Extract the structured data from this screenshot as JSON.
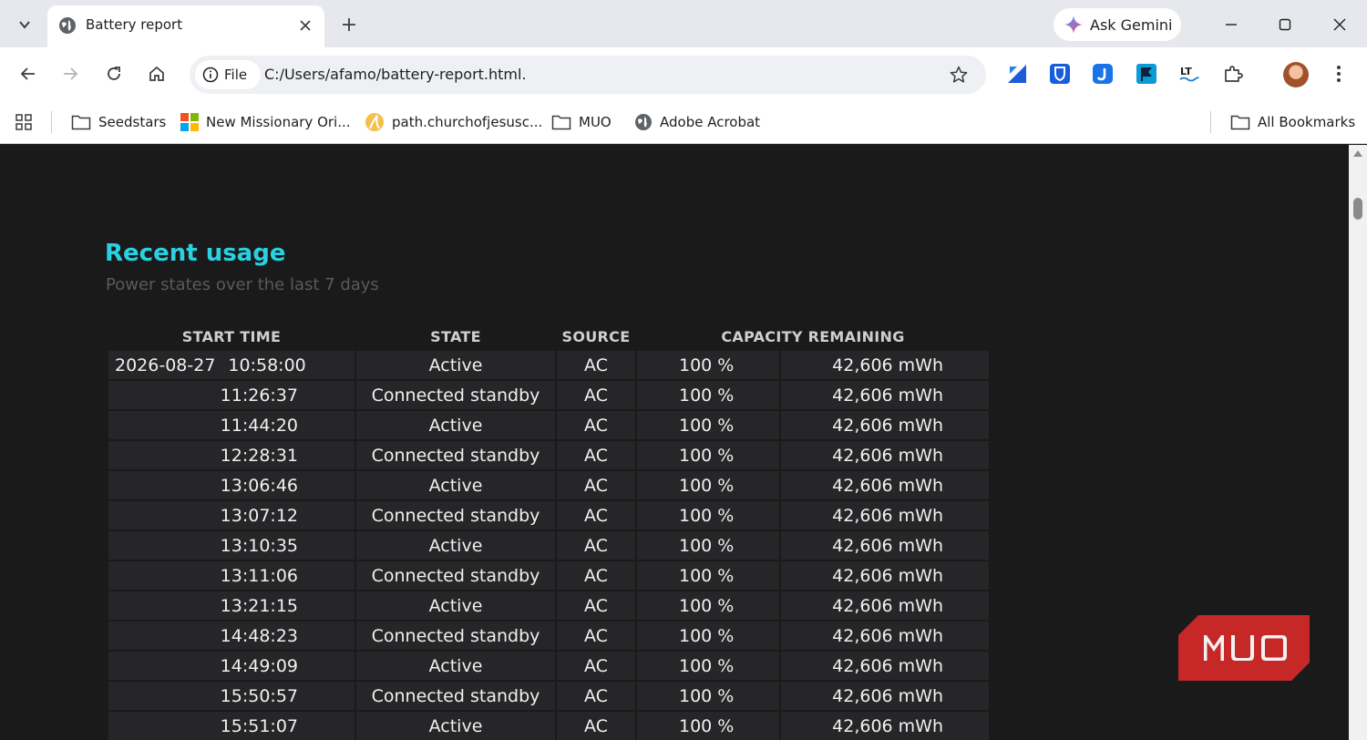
{
  "browser": {
    "tab_title": "Battery report",
    "ask_gemini_label": "Ask Gemini",
    "file_chip_label": "File",
    "url": "C:/Users/afamo/battery-report.html."
  },
  "bookmarks": {
    "items": [
      "Seedstars",
      "New Missionary Ori...",
      "path.churchofjesusc...",
      "MUO",
      "Adobe Acrobat"
    ],
    "all_bookmarks_label": "All Bookmarks"
  },
  "report": {
    "heading": "Recent usage",
    "subheading": "Power states over the last 7 days",
    "columns": [
      "START TIME",
      "STATE",
      "SOURCE",
      "CAPACITY REMAINING"
    ],
    "first_date": "2026-08-27",
    "rows": [
      {
        "time": "10:58:00",
        "state": "Active",
        "source": "AC",
        "percent": "100 %",
        "mwh": "42,606 mWh"
      },
      {
        "time": "11:26:37",
        "state": "Connected standby",
        "source": "AC",
        "percent": "100 %",
        "mwh": "42,606 mWh"
      },
      {
        "time": "11:44:20",
        "state": "Active",
        "source": "AC",
        "percent": "100 %",
        "mwh": "42,606 mWh"
      },
      {
        "time": "12:28:31",
        "state": "Connected standby",
        "source": "AC",
        "percent": "100 %",
        "mwh": "42,606 mWh"
      },
      {
        "time": "13:06:46",
        "state": "Active",
        "source": "AC",
        "percent": "100 %",
        "mwh": "42,606 mWh"
      },
      {
        "time": "13:07:12",
        "state": "Connected standby",
        "source": "AC",
        "percent": "100 %",
        "mwh": "42,606 mWh"
      },
      {
        "time": "13:10:35",
        "state": "Active",
        "source": "AC",
        "percent": "100 %",
        "mwh": "42,606 mWh"
      },
      {
        "time": "13:11:06",
        "state": "Connected standby",
        "source": "AC",
        "percent": "100 %",
        "mwh": "42,606 mWh"
      },
      {
        "time": "13:21:15",
        "state": "Active",
        "source": "AC",
        "percent": "100 %",
        "mwh": "42,606 mWh"
      },
      {
        "time": "14:48:23",
        "state": "Connected standby",
        "source": "AC",
        "percent": "100 %",
        "mwh": "42,606 mWh"
      },
      {
        "time": "14:49:09",
        "state": "Active",
        "source": "AC",
        "percent": "100 %",
        "mwh": "42,606 mWh"
      },
      {
        "time": "15:50:57",
        "state": "Connected standby",
        "source": "AC",
        "percent": "100 %",
        "mwh": "42,606 mWh"
      },
      {
        "time": "15:51:07",
        "state": "Active",
        "source": "AC",
        "percent": "100 %",
        "mwh": "42,606 mWh"
      }
    ]
  },
  "watermark": {
    "text": "MUO"
  },
  "colors": {
    "heading_accent": "#2ad1e0",
    "page_bg": "#1a1a1b",
    "row_bg": "#262628",
    "watermark_red": "#c62828"
  }
}
